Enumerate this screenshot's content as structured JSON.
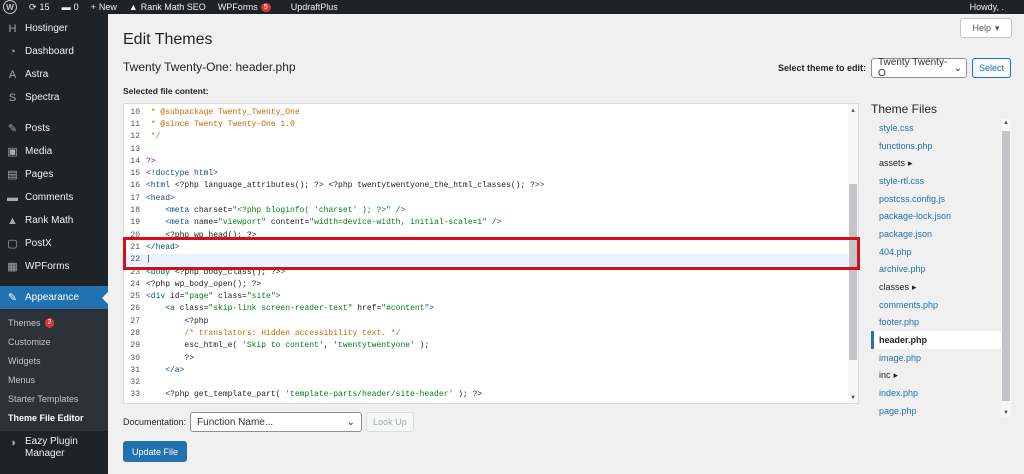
{
  "adminbar": {
    "updates": "15",
    "comments": "0",
    "new_label": "New",
    "rankmath_label": "Rank Math SEO",
    "wpforms_label": "WPForms",
    "wpforms_count": "5",
    "updraft_label": "UpdraftPlus",
    "howdy": "Howdy, ."
  },
  "sidebar": {
    "items": [
      {
        "label": "Hostinger",
        "icon": "hostinger-icon",
        "glyph": "H"
      },
      {
        "label": "Dashboard",
        "icon": "dashboard-icon",
        "glyph": "◔"
      },
      {
        "label": "Astra",
        "icon": "astra-icon",
        "glyph": "A"
      },
      {
        "label": "Spectra",
        "icon": "spectra-icon",
        "glyph": "S"
      },
      {
        "label": "Posts",
        "icon": "pin-icon",
        "glyph": "✎"
      },
      {
        "label": "Media",
        "icon": "media-icon",
        "glyph": "▣"
      },
      {
        "label": "Pages",
        "icon": "pages-icon",
        "glyph": "▤"
      },
      {
        "label": "Comments",
        "icon": "comment-icon",
        "glyph": "▬"
      },
      {
        "label": "Rank Math",
        "icon": "rankmath-icon",
        "glyph": "▲"
      },
      {
        "label": "PostX",
        "icon": "postx-icon",
        "glyph": "▢"
      },
      {
        "label": "WPForms",
        "icon": "wpforms-icon",
        "glyph": "▦"
      },
      {
        "label": "Appearance",
        "icon": "brush-icon",
        "glyph": "✎"
      }
    ],
    "submenu": [
      {
        "label": "Themes",
        "count": "2"
      },
      {
        "label": "Customize"
      },
      {
        "label": "Widgets"
      },
      {
        "label": "Menus"
      },
      {
        "label": "Starter Templates"
      },
      {
        "label": "Theme File Editor"
      }
    ],
    "plugin_manager": "Eazy Plugin Manager"
  },
  "main": {
    "help_label": "Help",
    "page_title": "Edit Themes",
    "file_title": "Twenty Twenty-One: header.php",
    "select_theme_label": "Select theme to edit:",
    "selected_theme": "Twenty Twenty-O",
    "select_button": "Select",
    "selected_file_label": "Selected file content:",
    "theme_files_heading": "Theme Files",
    "documentation_label": "Documentation:",
    "function_placeholder": "Function Name...",
    "lookup_button": "Look Up",
    "update_button": "Update File"
  },
  "editor_lines": [
    {
      "n": "10",
      "parts": [
        {
          "t": " * @subpackage Twenty_Twenty_One",
          "c": "c-doc"
        }
      ]
    },
    {
      "n": "11",
      "parts": [
        {
          "t": " * @since Twenty Twenty-One 1.0",
          "c": "c-doc"
        }
      ]
    },
    {
      "n": "12",
      "parts": [
        {
          "t": " */",
          "c": "c-doc"
        }
      ]
    },
    {
      "n": "13",
      "parts": [
        {
          "t": "",
          "c": ""
        }
      ]
    },
    {
      "n": "14",
      "parts": [
        {
          "t": "?>",
          "c": "c-php"
        }
      ]
    },
    {
      "n": "15",
      "parts": [
        {
          "t": "<!doctype html>",
          "c": "c-tag"
        }
      ]
    },
    {
      "n": "16",
      "parts": [
        {
          "t": "<html ",
          "c": "c-tag"
        },
        {
          "t": "<?php language_attributes(); ?> <?php twentytwentyone_the_html_classes(); ?>",
          "c": "c-attr"
        },
        {
          "t": ">",
          "c": "c-tag"
        }
      ]
    },
    {
      "n": "17",
      "parts": [
        {
          "t": "<head>",
          "c": "c-tag"
        }
      ]
    },
    {
      "n": "18",
      "parts": [
        {
          "t": "    <meta ",
          "c": "c-tag"
        },
        {
          "t": "charset=",
          "c": "c-attr"
        },
        {
          "t": "\"<?php bloginfo( 'charset' ); ?>\"",
          "c": "c-str"
        },
        {
          "t": " />",
          "c": "c-tag"
        }
      ]
    },
    {
      "n": "19",
      "parts": [
        {
          "t": "    <meta ",
          "c": "c-tag"
        },
        {
          "t": "name=",
          "c": "c-attr"
        },
        {
          "t": "\"viewport\"",
          "c": "c-str"
        },
        {
          "t": " content=",
          "c": "c-attr"
        },
        {
          "t": "\"width=device-width, initial-scale=1\"",
          "c": "c-str"
        },
        {
          "t": " />",
          "c": "c-tag"
        }
      ]
    },
    {
      "n": "20",
      "parts": [
        {
          "t": "    <?php wp_head(); ?>",
          "c": "c-attr"
        }
      ]
    },
    {
      "n": "21",
      "parts": [
        {
          "t": "</head>",
          "c": "c-tag"
        }
      ]
    },
    {
      "n": "22",
      "parts": [
        {
          "t": "|",
          "c": "c-attr"
        }
      ],
      "cursor": true
    },
    {
      "n": "23",
      "parts": [
        {
          "t": "<body ",
          "c": "c-tag"
        },
        {
          "t": "<?php body_class(); ?>",
          "c": "c-attr"
        },
        {
          "t": ">",
          "c": "c-tag"
        }
      ]
    },
    {
      "n": "24",
      "parts": [
        {
          "t": "<?php wp_body_open(); ?>",
          "c": "c-attr"
        }
      ]
    },
    {
      "n": "25",
      "parts": [
        {
          "t": "<div ",
          "c": "c-tag"
        },
        {
          "t": "id=",
          "c": "c-attr"
        },
        {
          "t": "\"page\"",
          "c": "c-str"
        },
        {
          "t": " class=",
          "c": "c-attr"
        },
        {
          "t": "\"site\"",
          "c": "c-str"
        },
        {
          "t": ">",
          "c": "c-tag"
        }
      ]
    },
    {
      "n": "26",
      "parts": [
        {
          "t": "    <a ",
          "c": "c-tag"
        },
        {
          "t": "class=",
          "c": "c-attr"
        },
        {
          "t": "\"skip-link screen-reader-text\"",
          "c": "c-str"
        },
        {
          "t": " href=",
          "c": "c-attr"
        },
        {
          "t": "\"#content\"",
          "c": "c-str"
        },
        {
          "t": ">",
          "c": "c-tag"
        }
      ]
    },
    {
      "n": "27",
      "parts": [
        {
          "t": "        <?php",
          "c": "c-attr"
        }
      ]
    },
    {
      "n": "28",
      "parts": [
        {
          "t": "        /* translators: Hidden accessibility text. */",
          "c": "c-doc"
        }
      ]
    },
    {
      "n": "29",
      "parts": [
        {
          "t": "        esc_html_e( ",
          "c": "c-attr"
        },
        {
          "t": "'Skip to content'",
          "c": "c-str"
        },
        {
          "t": ", ",
          "c": "c-attr"
        },
        {
          "t": "'twentytwentyone'",
          "c": "c-str"
        },
        {
          "t": " );",
          "c": "c-attr"
        }
      ]
    },
    {
      "n": "30",
      "parts": [
        {
          "t": "        ?>",
          "c": "c-attr"
        }
      ]
    },
    {
      "n": "31",
      "parts": [
        {
          "t": "    </a>",
          "c": "c-tag"
        }
      ]
    },
    {
      "n": "32",
      "parts": [
        {
          "t": "",
          "c": ""
        }
      ]
    },
    {
      "n": "33",
      "parts": [
        {
          "t": "    <?php get_template_part( ",
          "c": "c-attr"
        },
        {
          "t": "'template-parts/header/site-header'",
          "c": "c-str"
        },
        {
          "t": " ); ?>",
          "c": "c-attr"
        }
      ]
    }
  ],
  "theme_files": [
    {
      "name": "style.css"
    },
    {
      "name": "functions.php"
    },
    {
      "name": "assets",
      "folder": true
    },
    {
      "name": "style-rtl.css"
    },
    {
      "name": "postcss.config.js"
    },
    {
      "name": "package-lock.json"
    },
    {
      "name": "package.json"
    },
    {
      "name": "404.php"
    },
    {
      "name": "archive.php"
    },
    {
      "name": "classes",
      "folder": true
    },
    {
      "name": "comments.php"
    },
    {
      "name": "footer.php"
    },
    {
      "name": "header.php",
      "current": true
    },
    {
      "name": "image.php"
    },
    {
      "name": "inc",
      "folder": true
    },
    {
      "name": "index.php"
    },
    {
      "name": "page.php"
    }
  ]
}
